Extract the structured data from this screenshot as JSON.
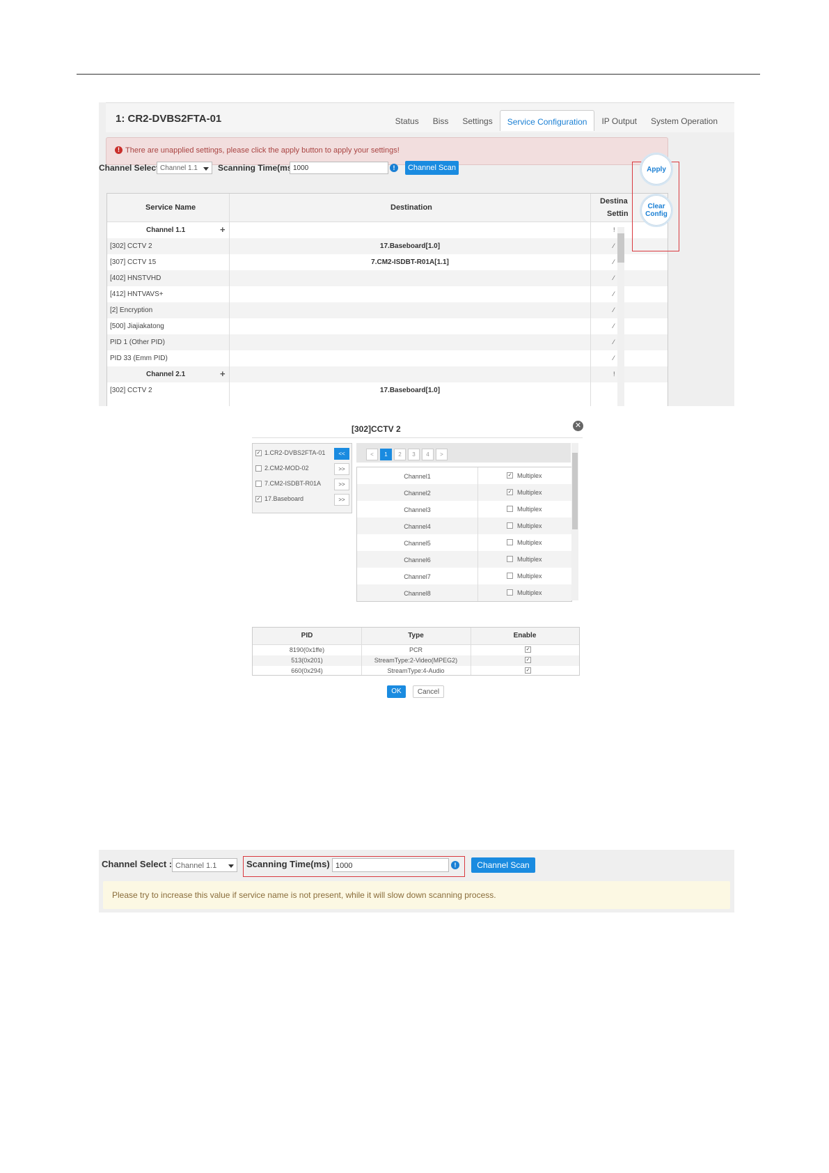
{
  "device_title": "1: CR2-DVBS2FTA-01",
  "tabs": [
    "Status",
    "Biss",
    "Settings",
    "Service Configuration",
    "IP Output",
    "System Operation"
  ],
  "alert": {
    "icon": "exclamation-icon",
    "text": "There are unapplied settings, please click the apply button to apply your settings!"
  },
  "controls": {
    "channel_select_label": "Channel Select :",
    "channel_select_value": "Channel 1.1",
    "scan_time_label": "Scanning Time(ms) :",
    "scan_time_value": "1000",
    "channel_scan_button": "Channel Scan"
  },
  "side_buttons": {
    "apply": "Apply",
    "clear_line1": "Clear",
    "clear_line2": "Config"
  },
  "table": {
    "headers": {
      "service_name": "Service Name",
      "destination": "Destination",
      "dest_setting_line1": "Destina",
      "dest_setting_line2": "Settin"
    },
    "rows": [
      {
        "name": "Channel 1.1",
        "group": true,
        "destination": "",
        "tail": "!"
      },
      {
        "name": "[302] CCTV 2",
        "group": false,
        "destination": "17.Baseboard[1.0]",
        "tail": "⁄"
      },
      {
        "name": "[307] CCTV 15",
        "group": false,
        "destination": "7.CM2-ISDBT-R01A[1.1]",
        "tail": "⁄"
      },
      {
        "name": "[402] HNSTVHD",
        "group": false,
        "destination": "",
        "tail": "⁄"
      },
      {
        "name": "[412] HNTVAVS+",
        "group": false,
        "destination": "",
        "tail": "⁄"
      },
      {
        "name": "[2] Encryption",
        "group": false,
        "destination": "",
        "tail": "⁄"
      },
      {
        "name": "[500] Jiajiakatong",
        "group": false,
        "destination": "",
        "tail": "⁄"
      },
      {
        "name": "PID 1 (Other PID)",
        "group": false,
        "destination": "",
        "tail": "⁄"
      },
      {
        "name": "PID 33 (Emm PID)",
        "group": false,
        "destination": "",
        "tail": "⁄"
      },
      {
        "name": "Channel 2.1",
        "group": true,
        "destination": "",
        "tail": "!"
      },
      {
        "name": "[302] CCTV 2",
        "group": false,
        "destination": "17.Baseboard[1.0]",
        "tail": ""
      }
    ]
  },
  "dialog": {
    "title": "[302]CCTV 2",
    "devices": [
      {
        "label": "1.CR2-DVBS2FTA-01",
        "checked": true,
        "arrow": "<<",
        "active": true
      },
      {
        "label": "2.CM2-MOD-02",
        "checked": false,
        "arrow": ">>",
        "active": false
      },
      {
        "label": "7.CM2-ISDBT-R01A",
        "checked": false,
        "arrow": ">>",
        "active": false
      },
      {
        "label": "17.Baseboard",
        "checked": true,
        "arrow": ">>",
        "active": false
      }
    ],
    "pager": [
      "<",
      "1",
      "2",
      "3",
      "4",
      ">"
    ],
    "current_page": "1",
    "channels": [
      {
        "name": "Channel1",
        "label": "Multiplex",
        "checked": true
      },
      {
        "name": "Channel2",
        "label": "Multiplex",
        "checked": true
      },
      {
        "name": "Channel3",
        "label": "Multiplex",
        "checked": false
      },
      {
        "name": "Channel4",
        "label": "Multiplex",
        "checked": false
      },
      {
        "name": "Channel5",
        "label": "Multiplex",
        "checked": false
      },
      {
        "name": "Channel6",
        "label": "Multiplex",
        "checked": false
      },
      {
        "name": "Channel7",
        "label": "Multiplex",
        "checked": false
      },
      {
        "name": "Channel8",
        "label": "Multiplex",
        "checked": false
      }
    ],
    "pid_headers": [
      "PID",
      "Type",
      "Enable"
    ],
    "pids": [
      {
        "pid": "8190(0x1ffe)",
        "type": "PCR",
        "enabled": true
      },
      {
        "pid": "513(0x201)",
        "type": "StreamType:2-Video(MPEG2)",
        "enabled": true
      },
      {
        "pid": "660(0x294)",
        "type": "StreamType:4-Audio",
        "enabled": true
      }
    ],
    "ok": "OK",
    "cancel": "Cancel"
  },
  "panel3": {
    "channel_select_label": "Channel Select :",
    "channel_select_value": "Channel 1.1",
    "scan_time_label": "Scanning Time(ms) :",
    "scan_time_value": "1000",
    "channel_scan_button": "Channel Scan",
    "tooltip": "Please try to increase this value if service name is not present, while it will slow down scanning process."
  },
  "colors": {
    "accent": "#1a8be0",
    "alert_bg": "#f2dede",
    "highlight_border": "#d9393f",
    "tooltip_bg": "#fcf8e3"
  }
}
